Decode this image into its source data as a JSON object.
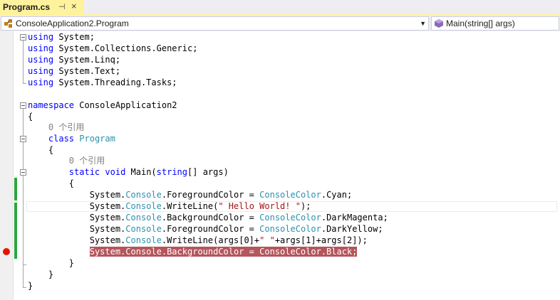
{
  "tab": {
    "title": "Program.cs",
    "pin_glyph": "⊣",
    "close_glyph": "×"
  },
  "nav": {
    "project": "ConsoleApplication2.Program",
    "member": "Main(string[] args)"
  },
  "colors": {
    "keyword": "#0000ff",
    "type": "#2b91af",
    "string": "#a31515",
    "reference_lens": "#808080",
    "breakpoint_highlight": "#b4565c",
    "breakpoint_dot": "#e51400",
    "change_bar": "#2ba63f",
    "tab_active": "#fff29d"
  },
  "code": {
    "l1": {
      "kw": "using",
      "rest": " System;"
    },
    "l2": {
      "kw": "using",
      "rest": " System.Collections.Generic;"
    },
    "l3": {
      "kw": "using",
      "rest": " System.Linq;"
    },
    "l4": {
      "kw": "using",
      "rest": " System.Text;"
    },
    "l5": {
      "kw": "using",
      "rest": " System.Threading.Tasks;"
    },
    "l7": {
      "kw": "namespace",
      "rest": " ConsoleApplication2"
    },
    "l8": {
      "text": "{"
    },
    "l9": {
      "ref": "    0 个引用"
    },
    "l10": {
      "pre": "    ",
      "kw": "class",
      "sp": " ",
      "type": "Program"
    },
    "l11": {
      "text": "    {"
    },
    "l12": {
      "ref": "        0 个引用"
    },
    "l13": {
      "pre": "        ",
      "kw": "static",
      "sp": " ",
      "kw2": "void",
      "mid": " Main(",
      "kw3": "string",
      "rest": "[] args)"
    },
    "l14": {
      "text": "        {"
    },
    "l15": {
      "a": "            System.",
      "t1": "Console",
      "b": ".ForegroundColor = ",
      "t2": "ConsoleColor",
      "c": ".Cyan;"
    },
    "l16": {
      "a": "            System.",
      "t1": "Console",
      "b": ".WriteLine(",
      "s": "\" Hello World! \"",
      "c": ");"
    },
    "l17": {
      "a": "            System.",
      "t1": "Console",
      "b": ".BackgroundColor = ",
      "t2": "ConsoleColor",
      "c": ".DarkMagenta;"
    },
    "l18": {
      "a": "            System.",
      "t1": "Console",
      "b": ".ForegroundColor = ",
      "t2": "ConsoleColor",
      "c": ".DarkYellow;"
    },
    "l19": {
      "a": "            System.",
      "t1": "Console",
      "b": ".WriteLine(args[0]+",
      "s": "\" \"",
      "c": "+args[1]+args[2]);"
    },
    "l20": {
      "pre": "            ",
      "hl": "System.Console.BackgroundColor = ConsoleColor.Black;"
    },
    "l21": {
      "text": "        }"
    },
    "l22": {
      "text": "    }"
    },
    "l23": {
      "text": "}"
    }
  }
}
